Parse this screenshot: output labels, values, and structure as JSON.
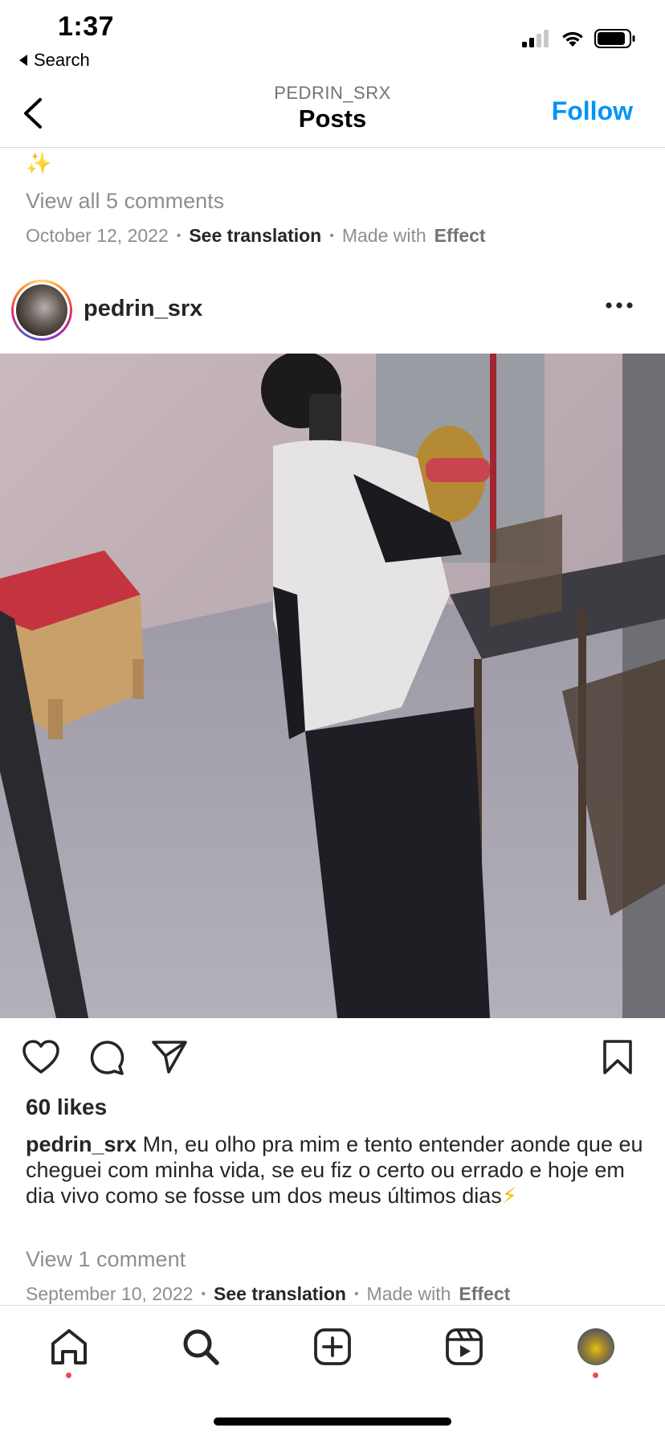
{
  "status_bar": {
    "time": "1:37",
    "back_app_label": "Search"
  },
  "header": {
    "username": "PEDRIN_SRX",
    "title": "Posts",
    "follow_label": "Follow"
  },
  "previous_post": {
    "sparkle": "✨",
    "view_comments": "View all 5 comments",
    "date": "October 12, 2022",
    "see_translation": "See translation",
    "made_with": "Made with",
    "effect": "Effect"
  },
  "post": {
    "username": "pedrin_srx",
    "likes": "60 likes",
    "caption_user": "pedrin_srx",
    "caption_text": "Mn, eu olho pra mim e tento entender aonde que eu cheguei com minha vida, se eu fiz o certo ou errado e hoje em dia vivo como se fosse um dos meus últimos dias",
    "caption_emoji": "⚡",
    "view_comment": "View 1 comment",
    "date": "September 10, 2022",
    "see_translation": "See translation",
    "made_with": "Made with",
    "effect": "Effect"
  },
  "colors": {
    "accent": "#0095f6",
    "notification_dot": "#ed4956"
  },
  "icons": [
    "back-chevron-icon",
    "more-options-icon",
    "heart-icon",
    "comment-icon",
    "share-icon",
    "bookmark-icon",
    "home-icon",
    "search-icon",
    "create-icon",
    "reels-icon",
    "profile-avatar"
  ]
}
